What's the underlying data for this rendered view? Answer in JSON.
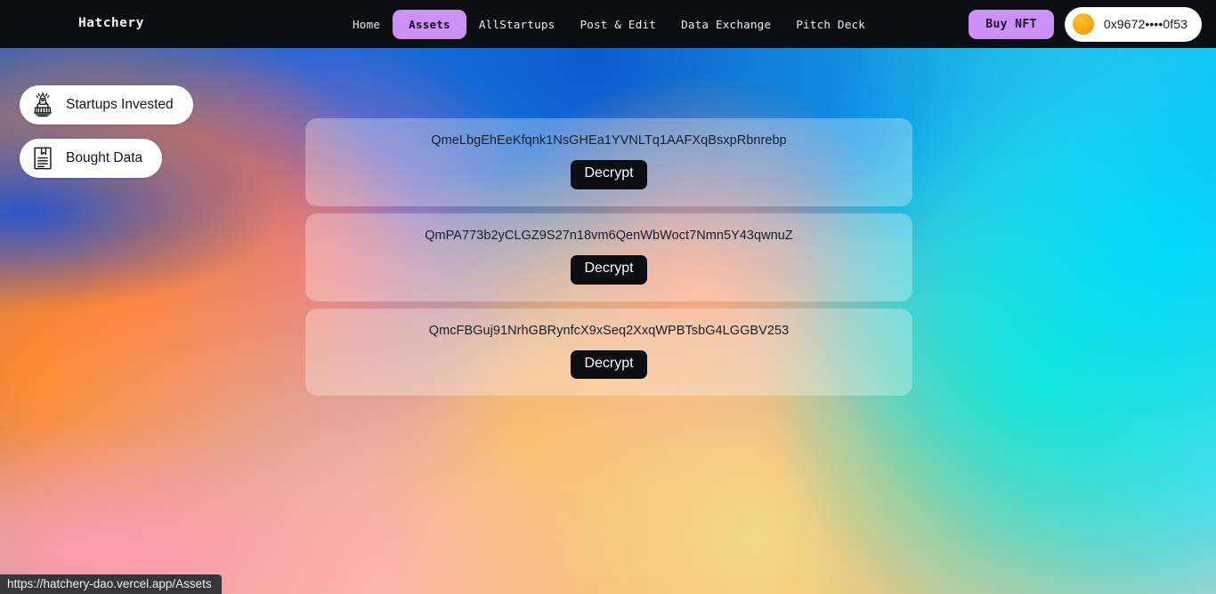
{
  "navbar": {
    "brand": "Hatchery",
    "links": [
      {
        "label": "Home",
        "active": false
      },
      {
        "label": "Assets",
        "active": true
      },
      {
        "label": "AllStartups",
        "active": false
      },
      {
        "label": "Post & Edit",
        "active": false
      },
      {
        "label": "Data Exchange",
        "active": false
      },
      {
        "label": "Pitch Deck",
        "active": false
      }
    ],
    "buy_nft_label": "Buy NFT",
    "wallet": {
      "address": "0x9672••••0f53",
      "avatar_icon": "wallet-avatar-icon",
      "avatar_color": "#f5a60d"
    },
    "background_color": "#0d0d14",
    "accent_color": "#cb91f7"
  },
  "sidebar": {
    "items": [
      {
        "label": "Startups Invested",
        "icon": "rocket-launch-icon"
      },
      {
        "label": "Bought Data",
        "icon": "bookmarked-document-icon"
      }
    ]
  },
  "main": {
    "cards": [
      {
        "hash": "QmeLbgEhEeKfqnk1NsGHEa1YVNLTq1AAFXqBsxpRbnrebp",
        "button_label": "Decrypt"
      },
      {
        "hash": "QmPA773b2yCLGZ9S27n18vm6QenWbWoct7Nmn5Y43qwnuZ",
        "button_label": "Decrypt"
      },
      {
        "hash": "QmcFBGuj91NrhGBRynfcX9xSeq2XxqWPBTsbG4LGGBV253",
        "button_label": "Decrypt"
      }
    ]
  },
  "status_bar": {
    "url": "https://hatchery-dao.vercel.app/Assets"
  }
}
